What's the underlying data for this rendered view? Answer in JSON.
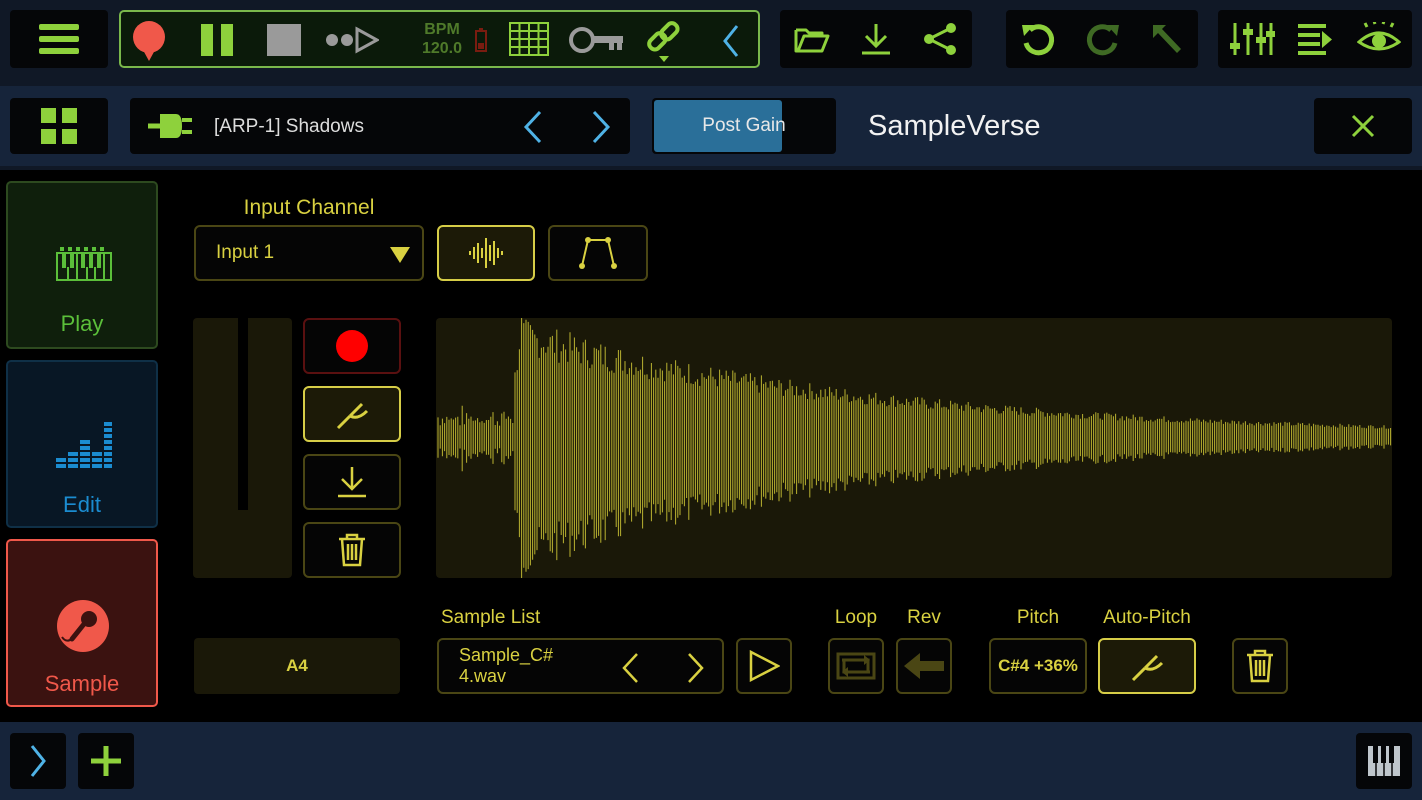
{
  "transport": {
    "bpm_label": "BPM",
    "bpm_value": "120.0"
  },
  "toolbar_icons": {
    "menu": "hamburger-menu-icon",
    "record": "record-icon",
    "pause": "pause-icon",
    "stop": "stop-icon",
    "step": "step-forward-icon",
    "battery": "battery-icon",
    "grid": "grid-icon",
    "key": "key-icon",
    "link": "link-icon",
    "collapse": "chevron-left-icon",
    "open": "folder-open-icon",
    "download": "download-icon",
    "share": "share-icon",
    "undo": "undo-icon",
    "redo": "redo-icon",
    "cursor": "pointer-icon",
    "mixer": "mixer-sliders-icon",
    "list": "list-arrow-icon",
    "eye": "eye-icon"
  },
  "plugin_bar": {
    "preset_name": "[ARP-1] Shadows",
    "post_gain": "Post Gain",
    "plugin_title": "SampleVerse"
  },
  "modes": [
    {
      "label": "Play",
      "icon": "keyboard-icon",
      "color": "#5bbf3a"
    },
    {
      "label": "Edit",
      "icon": "equalizer-icon",
      "color": "#1b8cd0"
    },
    {
      "label": "Sample",
      "icon": "microphone-icon",
      "color": "#f0584a"
    }
  ],
  "input": {
    "heading": "Input Channel",
    "selected": "Input 1"
  },
  "note": "A4",
  "sample_list": {
    "heading": "Sample List",
    "current_line1": "Sample_C#",
    "current_line2": "4.wav"
  },
  "labels": {
    "loop": "Loop",
    "rev": "Rev",
    "pitch": "Pitch",
    "auto_pitch": "Auto-Pitch"
  },
  "pitch_value": "C#4 +36%",
  "colors": {
    "accent_yellow": "#d9d141",
    "accent_green": "#8ed13c",
    "waveform": "#b9b230",
    "record_red": "#ff0000",
    "post_gain_blue": "#2a6f99"
  }
}
